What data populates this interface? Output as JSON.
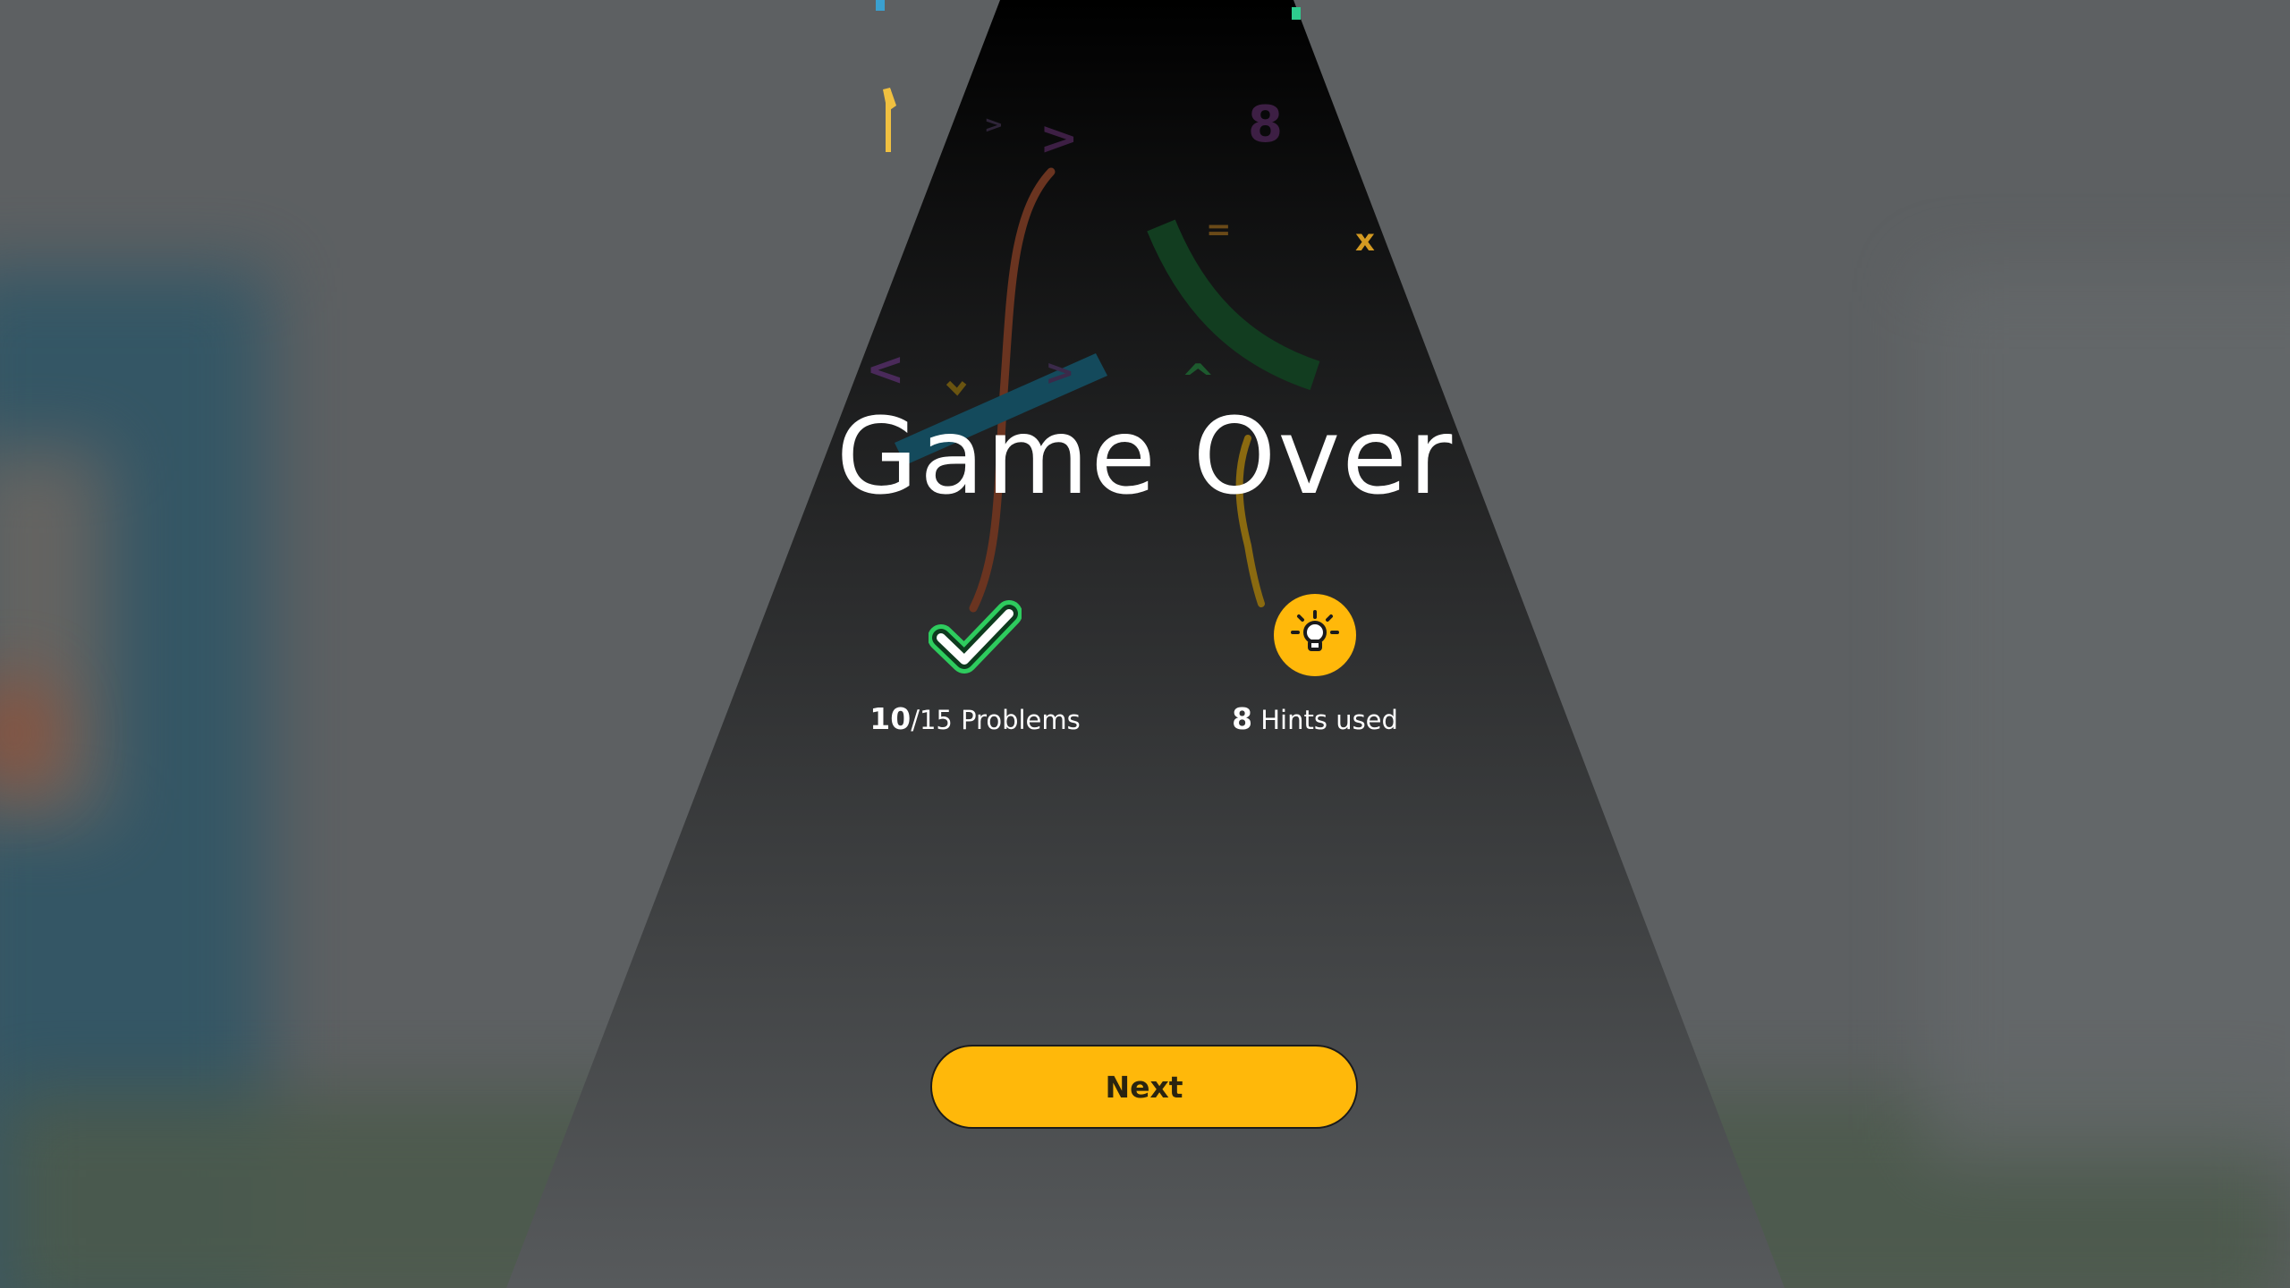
{
  "game_over": {
    "title": "Game Over",
    "problems": {
      "solved": "10",
      "total_suffix": "/15 Problems",
      "icon": "checkmark-icon"
    },
    "hints": {
      "count": "8",
      "label_suffix": " Hints used",
      "icon": "lightbulb-icon"
    },
    "next_label": "Next"
  },
  "colors": {
    "accent": "#ffb80a",
    "check_green": "#2ecc5e",
    "spotlight_top": "#000000",
    "spotlight_bottom": "#575a5c",
    "backdrop": "#5d6062"
  }
}
